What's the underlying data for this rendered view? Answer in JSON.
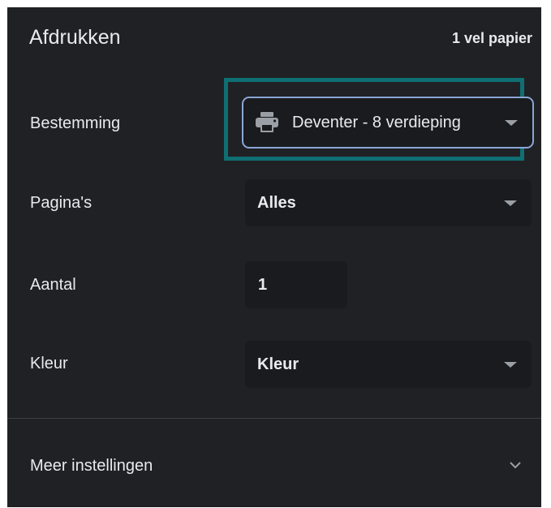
{
  "header": {
    "title": "Afdrukken",
    "sheets": "1 vel papier"
  },
  "destination": {
    "label": "Bestemming",
    "value": "Deventer - 8 verdieping",
    "icon": "printer-icon"
  },
  "pages": {
    "label": "Pagina's",
    "value": "Alles"
  },
  "copies": {
    "label": "Aantal",
    "value": "1"
  },
  "color": {
    "label": "Kleur",
    "value": "Kleur"
  },
  "more_settings": {
    "label": "Meer instellingen",
    "icon": "chevron-down-icon"
  },
  "colors": {
    "panel_bg": "#202124",
    "field_bg": "#1a1b1e",
    "highlight": "#0f6f73",
    "focus_border": "#8aa6d6",
    "text": "#e8eaed"
  }
}
